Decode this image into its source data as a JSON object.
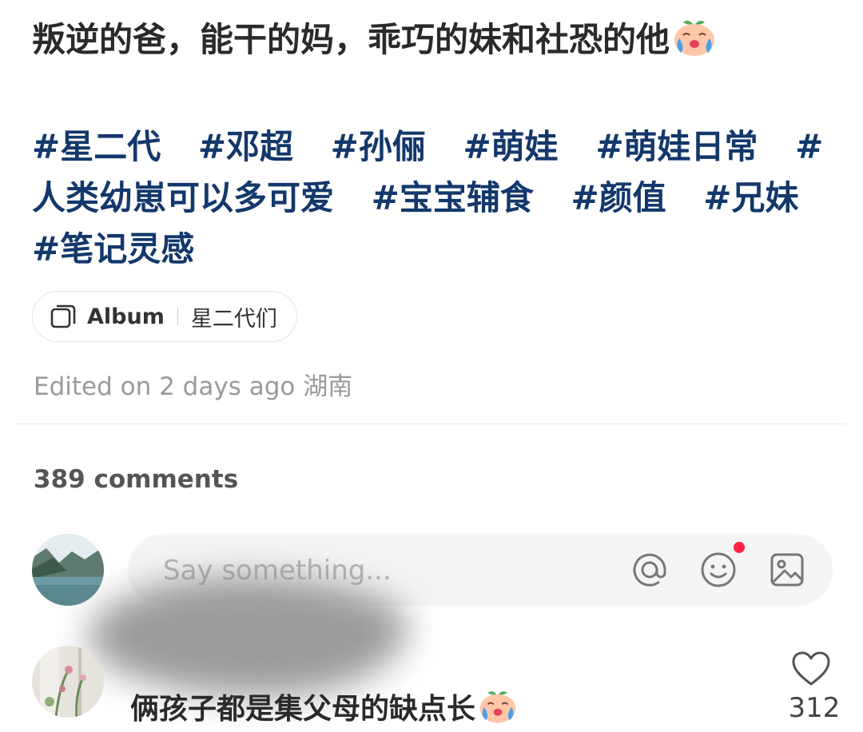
{
  "post": {
    "title": "叛逆的爸，能干的妈，乖巧的妹和社恐的他",
    "title_emoji": "crying-peach-emoji",
    "tags": [
      "#星二代",
      "#邓超",
      "#孙俪",
      "#萌娃",
      "#萌娃日常",
      "#人类幼崽可以多可爱",
      "#宝宝辅食",
      "#颜值",
      "#兄妹",
      "#笔记灵感"
    ],
    "album": {
      "label": "Album",
      "name": "星二代们",
      "icon": "album-icon"
    },
    "edited": "Edited on 2 days ago 湖南"
  },
  "comments": {
    "count_label": "389 comments",
    "input": {
      "placeholder": "Say something...",
      "value": ""
    },
    "input_icons": [
      "at-icon",
      "emoji-icon",
      "image-icon"
    ],
    "items": [
      {
        "text": "俩孩子都是集父母的缺点长",
        "emoji": "crying-peach-emoji",
        "likes": "312"
      }
    ]
  },
  "colors": {
    "tag": "#13386b",
    "notification_dot": "#ff2442",
    "muted": "#9a9a9a"
  }
}
